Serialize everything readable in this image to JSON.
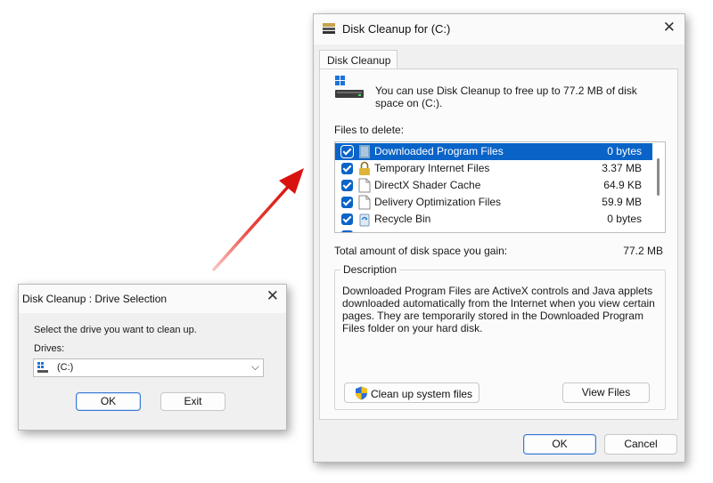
{
  "drive_selection": {
    "title": "Disk Cleanup : Drive Selection",
    "prompt": "Select the drive you want to clean up.",
    "drives_label": "Drives:",
    "selected_drive": "(C:)",
    "ok_label": "OK",
    "exit_label": "Exit"
  },
  "disk_cleanup": {
    "title": "Disk Cleanup for  (C:)",
    "tab_label": "Disk Cleanup",
    "intro": "You can use Disk Cleanup to free up to 77.2 MB of disk space on  (C:).",
    "files_to_delete_label": "Files to delete:",
    "files": [
      {
        "name": "Downloaded Program Files",
        "size": "0 bytes",
        "icon": "folder-icon",
        "checked": true
      },
      {
        "name": "Temporary Internet Files",
        "size": "3.37 MB",
        "icon": "lock-icon",
        "checked": true
      },
      {
        "name": "DirectX Shader Cache",
        "size": "64.9 KB",
        "icon": "file-icon",
        "checked": true
      },
      {
        "name": "Delivery Optimization Files",
        "size": "59.9 MB",
        "icon": "file-icon",
        "checked": true
      },
      {
        "name": "Recycle Bin",
        "size": "0 bytes",
        "icon": "recycle-bin-icon",
        "checked": true
      }
    ],
    "total_label": "Total amount of disk space you gain:",
    "total_value": "77.2 MB",
    "description_label": "Description",
    "description_text": "Downloaded Program Files are ActiveX controls and Java applets downloaded automatically from the Internet when you view certain pages. They are temporarily stored in the Downloaded Program Files folder on your hard disk.",
    "cleanup_system_label": "Clean up system files",
    "view_files_label": "View Files",
    "ok_label": "OK",
    "cancel_label": "Cancel"
  },
  "colors": {
    "selection": "#0a64c8",
    "arrow": "#e0211b",
    "dialog_bg": "#f0f0f0"
  }
}
